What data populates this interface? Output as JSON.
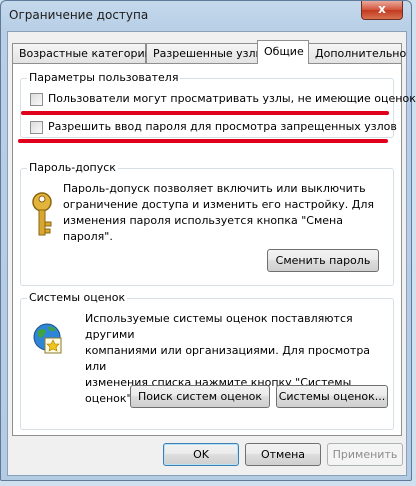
{
  "window": {
    "title": "Ограничение доступа",
    "close_label": "x"
  },
  "tabs": [
    {
      "label": "Возрастные категории",
      "active": false
    },
    {
      "label": "Разрешенные узлы",
      "active": false
    },
    {
      "label": "Общие",
      "active": true
    },
    {
      "label": "Дополнительно",
      "active": false
    }
  ],
  "user_params": {
    "title": "Параметры пользователя",
    "checkbox1": {
      "label": "Пользователи могут просматривать узлы, не имеющие оценок",
      "checked": false
    },
    "checkbox2": {
      "label": "Разрешить ввод пароля для просмотра запрещенных узлов",
      "checked": false
    }
  },
  "password": {
    "title": "Пароль-допуск",
    "description_lines": [
      "Пароль-допуск позволяет включить или выключить",
      "ограничение доступа и изменить его настройку. Для",
      "изменения пароля используется кнопка \"Смена пароля\"."
    ],
    "change_button": "Сменить пароль"
  },
  "rating_systems": {
    "title": "Системы оценок",
    "description_lines": [
      "Используемые системы оценок поставляются другими",
      "компаниями или организациями. Для просмотра или",
      "изменения списка нажмите кнопку \"Системы оценок\"."
    ],
    "find_button": "Поиск систем оценок",
    "systems_button": "Системы оценок..."
  },
  "footer": {
    "ok": "OK",
    "cancel": "Отмена",
    "apply": "Применить"
  },
  "colors": {
    "highlight_underline": "#e0001b",
    "window_frame": "#b8cfe6"
  }
}
